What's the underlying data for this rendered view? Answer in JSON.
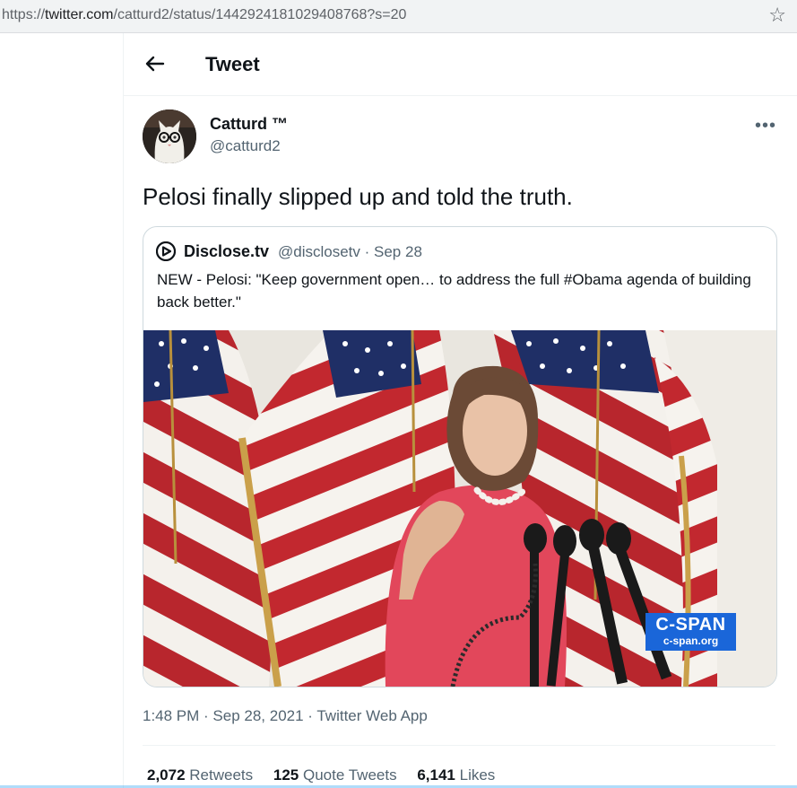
{
  "browser": {
    "url_prefix": "https://",
    "url_domain": "twitter.com",
    "url_path": "/catturd2/status/1442924181029408768?s=20",
    "bookmark_icon": "star-outline-icon"
  },
  "header": {
    "back_icon": "arrow-left-icon",
    "title": "Tweet"
  },
  "tweet": {
    "author_name": "Catturd ™",
    "author_handle": "@catturd2",
    "more_label": "•••",
    "text": "Pelosi finally slipped up and told the truth.",
    "timestamp": "1:48 PM · Sep 28, 2021 · Twitter Web App"
  },
  "quoted_tweet": {
    "author_name": "Disclose.tv",
    "author_handle": "@disclosetv",
    "date": "Sep 28",
    "text": "NEW - Pelosi: \"Keep government open… to address the full #Obama agenda of building back better.\"",
    "media_overlay_line1": "C-SPAN",
    "media_overlay_line2": "c-span.org"
  },
  "stats": {
    "retweets_count": "2,072",
    "retweets_label": "Retweets",
    "quotes_count": "125",
    "quotes_label": "Quote Tweets",
    "likes_count": "6,141",
    "likes_label": "Likes"
  },
  "colors": {
    "text_primary": "#0f1419",
    "text_secondary": "#536471",
    "border": "#cfd9de",
    "accent": "#1d9bf0"
  }
}
